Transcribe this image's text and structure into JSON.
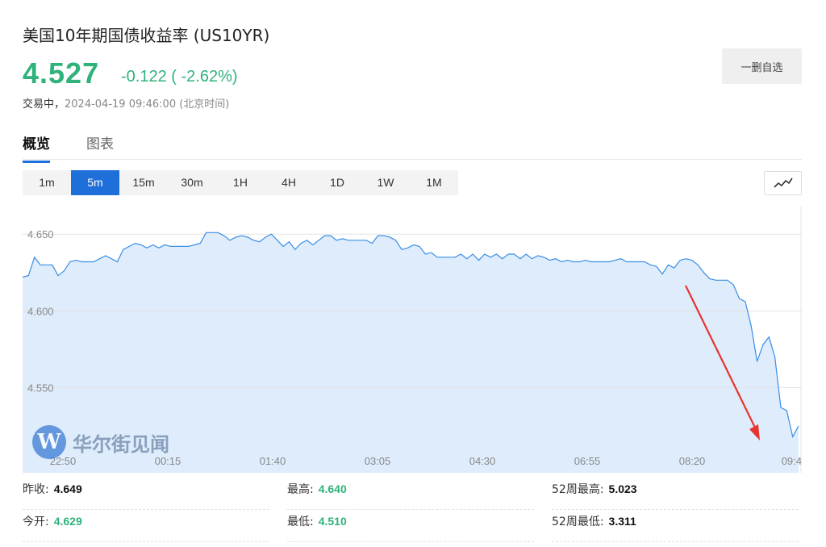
{
  "header": {
    "title": "美国10年期国债收益率 (US10YR)",
    "price": "4.527",
    "change": "-0.122 ( -2.62%)",
    "status_label": "交易中，",
    "timestamp": "2024-04-19 09:46:00 (北京时间)",
    "watch_button": "一删自选",
    "color_down": "#2fb37a"
  },
  "tabs": [
    {
      "label": "概览",
      "active": true
    },
    {
      "label": "图表",
      "active": false
    }
  ],
  "intervals": [
    {
      "label": "1m"
    },
    {
      "label": "5m",
      "active": true
    },
    {
      "label": "15m"
    },
    {
      "label": "30m"
    },
    {
      "label": "1H"
    },
    {
      "label": "4H"
    },
    {
      "label": "1D"
    },
    {
      "label": "1W"
    },
    {
      "label": "1M"
    }
  ],
  "chart_type_icon": "line-chart-icon",
  "watermark": {
    "logo": "W",
    "text": "华尔街见闻"
  },
  "chart_data": {
    "type": "area",
    "y_ticks": [
      "4.650",
      "4.600",
      "4.550"
    ],
    "y_tick_values": [
      4.65,
      4.6,
      4.55
    ],
    "x_ticks": [
      "22:50",
      "00:15",
      "01:40",
      "03:05",
      "04:30",
      "06:55",
      "08:20",
      "09:4"
    ],
    "ylim": [
      4.505,
      4.668
    ],
    "values": [
      4.622,
      4.623,
      4.635,
      4.63,
      4.63,
      4.63,
      4.623,
      4.626,
      4.632,
      4.633,
      4.632,
      4.632,
      4.632,
      4.634,
      4.636,
      4.634,
      4.632,
      4.64,
      4.642,
      4.644,
      4.643,
      4.641,
      4.643,
      4.641,
      4.643,
      4.642,
      4.642,
      4.642,
      4.642,
      4.643,
      4.644,
      4.651,
      4.651,
      4.651,
      4.649,
      4.646,
      4.648,
      4.649,
      4.648,
      4.646,
      4.645,
      4.648,
      4.65,
      4.646,
      4.642,
      4.645,
      4.64,
      4.644,
      4.646,
      4.643,
      4.646,
      4.649,
      4.649,
      4.646,
      4.647,
      4.646,
      4.646,
      4.646,
      4.646,
      4.644,
      4.649,
      4.649,
      4.648,
      4.646,
      4.64,
      4.641,
      4.643,
      4.642,
      4.637,
      4.638,
      4.635,
      4.635,
      4.635,
      4.635,
      4.637,
      4.634,
      4.637,
      4.633,
      4.637,
      4.635,
      4.637,
      4.634,
      4.637,
      4.637,
      4.634,
      4.637,
      4.634,
      4.636,
      4.635,
      4.633,
      4.634,
      4.632,
      4.633,
      4.632,
      4.632,
      4.633,
      4.632,
      4.632,
      4.632,
      4.632,
      4.633,
      4.634,
      4.632,
      4.632,
      4.632,
      4.632,
      4.63,
      4.629,
      4.624,
      4.63,
      4.628,
      4.633,
      4.634,
      4.633,
      4.63,
      4.625,
      4.621,
      4.62,
      4.62,
      4.62,
      4.617,
      4.608,
      4.606,
      4.59,
      4.567,
      4.578,
      4.583,
      4.57,
      4.537,
      4.535,
      4.518,
      4.525
    ],
    "line_color": "#3a8ee6",
    "fill_color": "#deecfb",
    "grid": true,
    "annotation": "red arrow pointing down"
  },
  "stats": [
    {
      "label": "昨收:",
      "value": "4.649",
      "tone": "dark"
    },
    {
      "label": "最高:",
      "value": "4.640",
      "tone": "green"
    },
    {
      "label": "52周最高:",
      "value": "5.023",
      "tone": "dark"
    },
    {
      "label": "今开:",
      "value": "4.629",
      "tone": "green"
    },
    {
      "label": "最低:",
      "value": "4.510",
      "tone": "green"
    },
    {
      "label": "52周最低:",
      "value": "3.311",
      "tone": "dark"
    }
  ]
}
